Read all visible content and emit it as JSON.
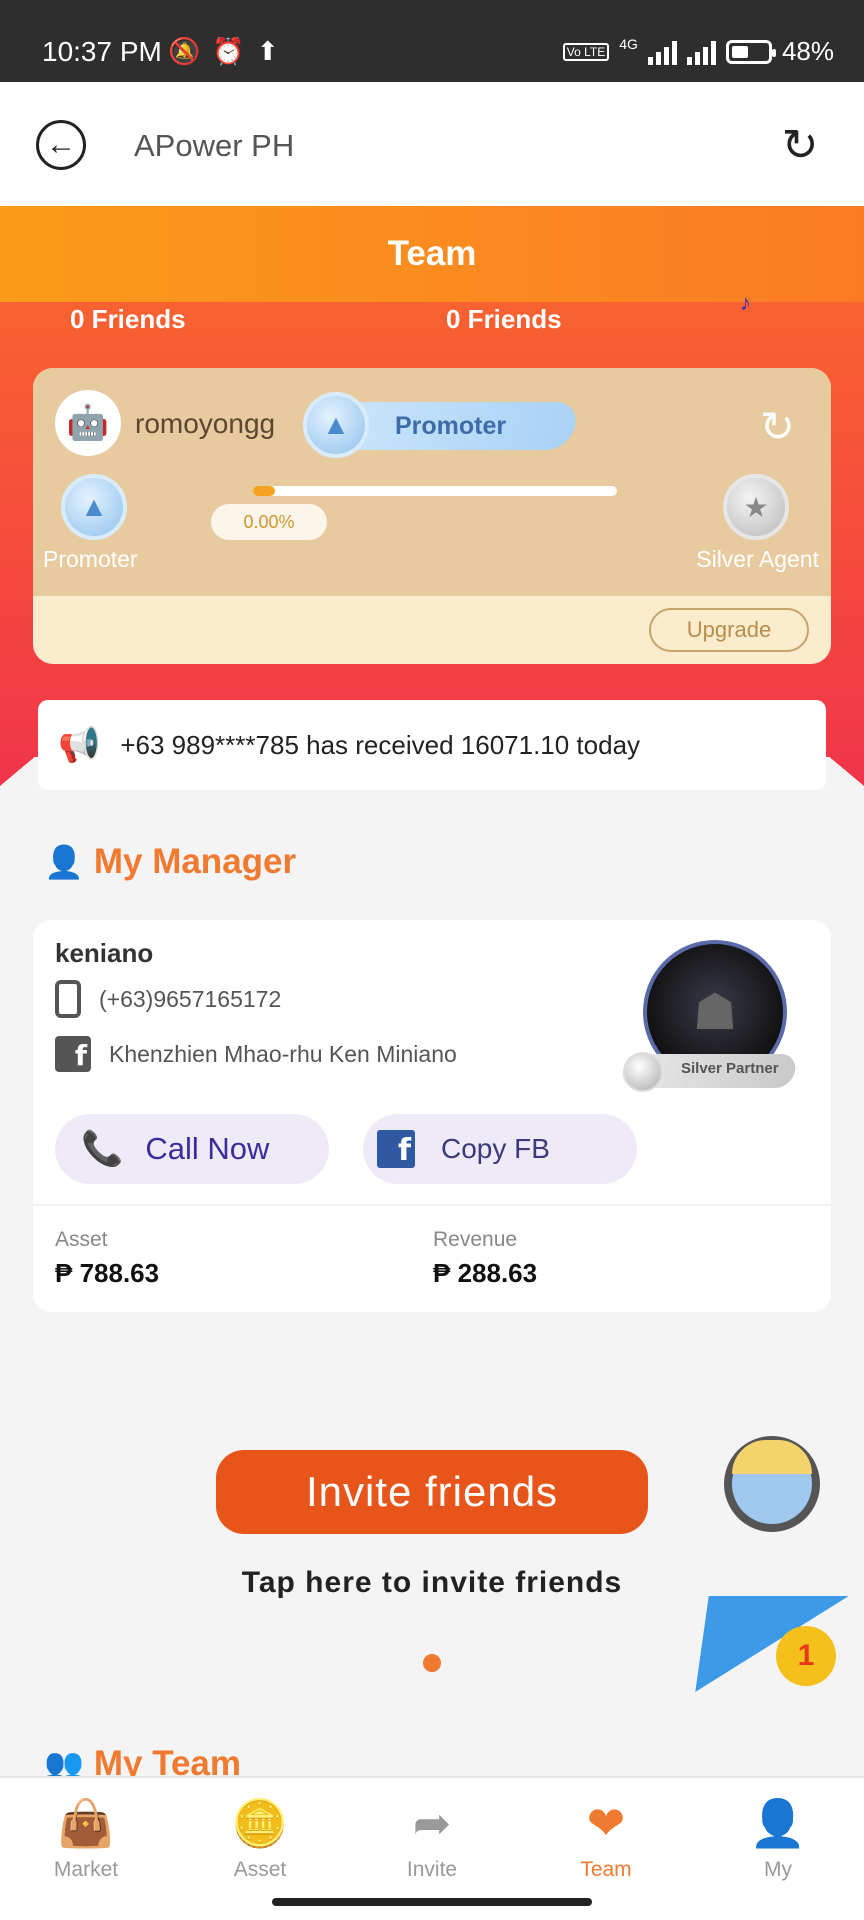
{
  "status_bar": {
    "time": "10:37 PM",
    "network": "4G",
    "volte": "Vo LTE",
    "battery": "48%",
    "battery_level": 0.48
  },
  "header": {
    "title": "APower PH"
  },
  "team": {
    "banner": "Team",
    "friends_left": "0 Friends",
    "friends_right": "0 Friends"
  },
  "level_card": {
    "username": "romoyongg",
    "current_level": "Promoter",
    "left_level": "Promoter",
    "right_level": "Silver Agent",
    "progress_label": "0.00%",
    "progress_value": 0.0,
    "upgrade": "Upgrade"
  },
  "notice": {
    "text": "+63 989****785 has received 16071.10 today"
  },
  "manager": {
    "section_title": "My Manager",
    "name": "keniano",
    "phone": "(+63)9657165172",
    "facebook": "Khenzhien Mhao-rhu Ken Miniano",
    "badge": "Silver Partner",
    "call_label": "Call Now",
    "copy_label": "Copy FB",
    "asset_label": "Asset",
    "asset_value": "₱ 788.63",
    "revenue_label": "Revenue",
    "revenue_value": "₱ 288.63"
  },
  "invite": {
    "button": "Invite friends",
    "hint": "Tap here to invite friends",
    "plane_badge": "1"
  },
  "my_team": {
    "section_title": "My Team"
  },
  "tabs": [
    {
      "label": "Market",
      "icon": "bag-icon"
    },
    {
      "label": "Asset",
      "icon": "coins-icon"
    },
    {
      "label": "Invite",
      "icon": "share-icon"
    },
    {
      "label": "Team",
      "icon": "heart-handshake-icon"
    },
    {
      "label": "My",
      "icon": "user-icon"
    }
  ],
  "colors": {
    "accent": "#f07a2f",
    "hero": "#f64a3d",
    "invite": "#e8551a",
    "call": "#3b2e9c"
  }
}
